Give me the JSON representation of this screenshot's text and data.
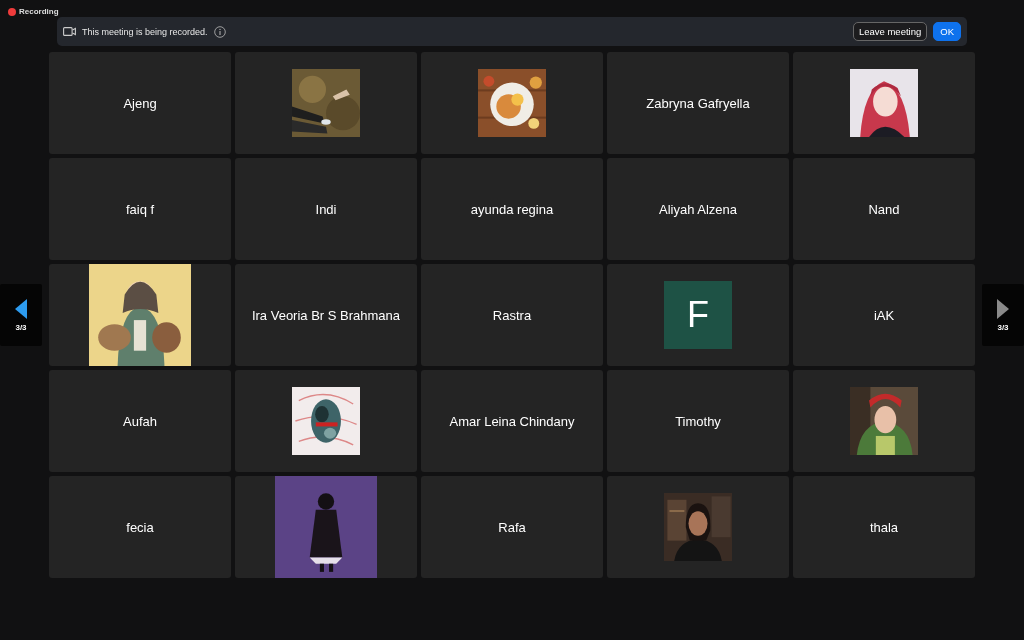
{
  "recording_indicator": {
    "label": "Recording"
  },
  "banner": {
    "message": "This meeting is being recorded.",
    "buttons": [
      {
        "label": "Leave meeting",
        "kind": "secondary"
      },
      {
        "label": "OK",
        "kind": "primary"
      }
    ]
  },
  "pager_left": {
    "page": "3/3",
    "disabled": false
  },
  "pager_right": {
    "page": "3/3",
    "disabled": true
  },
  "tiles": [
    {
      "kind": "name",
      "name": "Ajeng"
    },
    {
      "kind": "picture"
    },
    {
      "kind": "picture"
    },
    {
      "kind": "name",
      "name": "Zabryna Gafryella"
    },
    {
      "kind": "picture"
    },
    {
      "kind": "name",
      "name": "faiq f"
    },
    {
      "kind": "name",
      "name": "Indi"
    },
    {
      "kind": "name",
      "name": "ayunda regina"
    },
    {
      "kind": "name",
      "name": "Aliyah Alzena"
    },
    {
      "kind": "name",
      "name": "Nand"
    },
    {
      "kind": "large-picture"
    },
    {
      "kind": "name",
      "name": "Ira Veoria Br S Brahmana"
    },
    {
      "kind": "name",
      "name": "Rastra"
    },
    {
      "kind": "initial",
      "initial": "F"
    },
    {
      "kind": "name",
      "name": "iAK"
    },
    {
      "kind": "name",
      "name": "Aufah"
    },
    {
      "kind": "picture"
    },
    {
      "kind": "name",
      "name": "Amar Leina Chindany"
    },
    {
      "kind": "name",
      "name": "Timothy"
    },
    {
      "kind": "picture"
    },
    {
      "kind": "name",
      "name": "fecia"
    },
    {
      "kind": "large-picture"
    },
    {
      "kind": "name",
      "name": "Rafa"
    },
    {
      "kind": "picture"
    },
    {
      "kind": "name",
      "name": "thala"
    }
  ]
}
